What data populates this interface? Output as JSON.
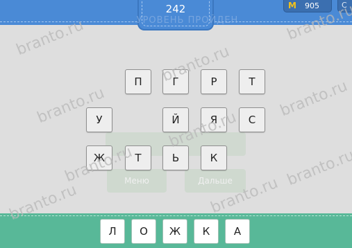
{
  "header": {
    "level": "242",
    "coins": "905",
    "coin_symbol": "M",
    "corner_text": "C",
    "faded_title": "УРОВЕНЬ ПРОЙДЕН"
  },
  "ghost": {
    "yellow_label": "ж",
    "button_left": "Меню",
    "button_right": "Дальше"
  },
  "grid": {
    "row1": [
      "П",
      "Г",
      "Р",
      "Т"
    ],
    "row2": [
      "У",
      "Й",
      "Я",
      "С"
    ],
    "row3": [
      "Ж",
      "Т",
      "Ь",
      "К"
    ]
  },
  "answer": [
    "Л",
    "О",
    "Ж",
    "К",
    "А"
  ],
  "watermark": "branto.ru",
  "colors": {
    "header_blue": "#4a8ad6",
    "footer_green": "#58b898",
    "background": "#dedede",
    "coin_yellow": "#f3c21a"
  }
}
